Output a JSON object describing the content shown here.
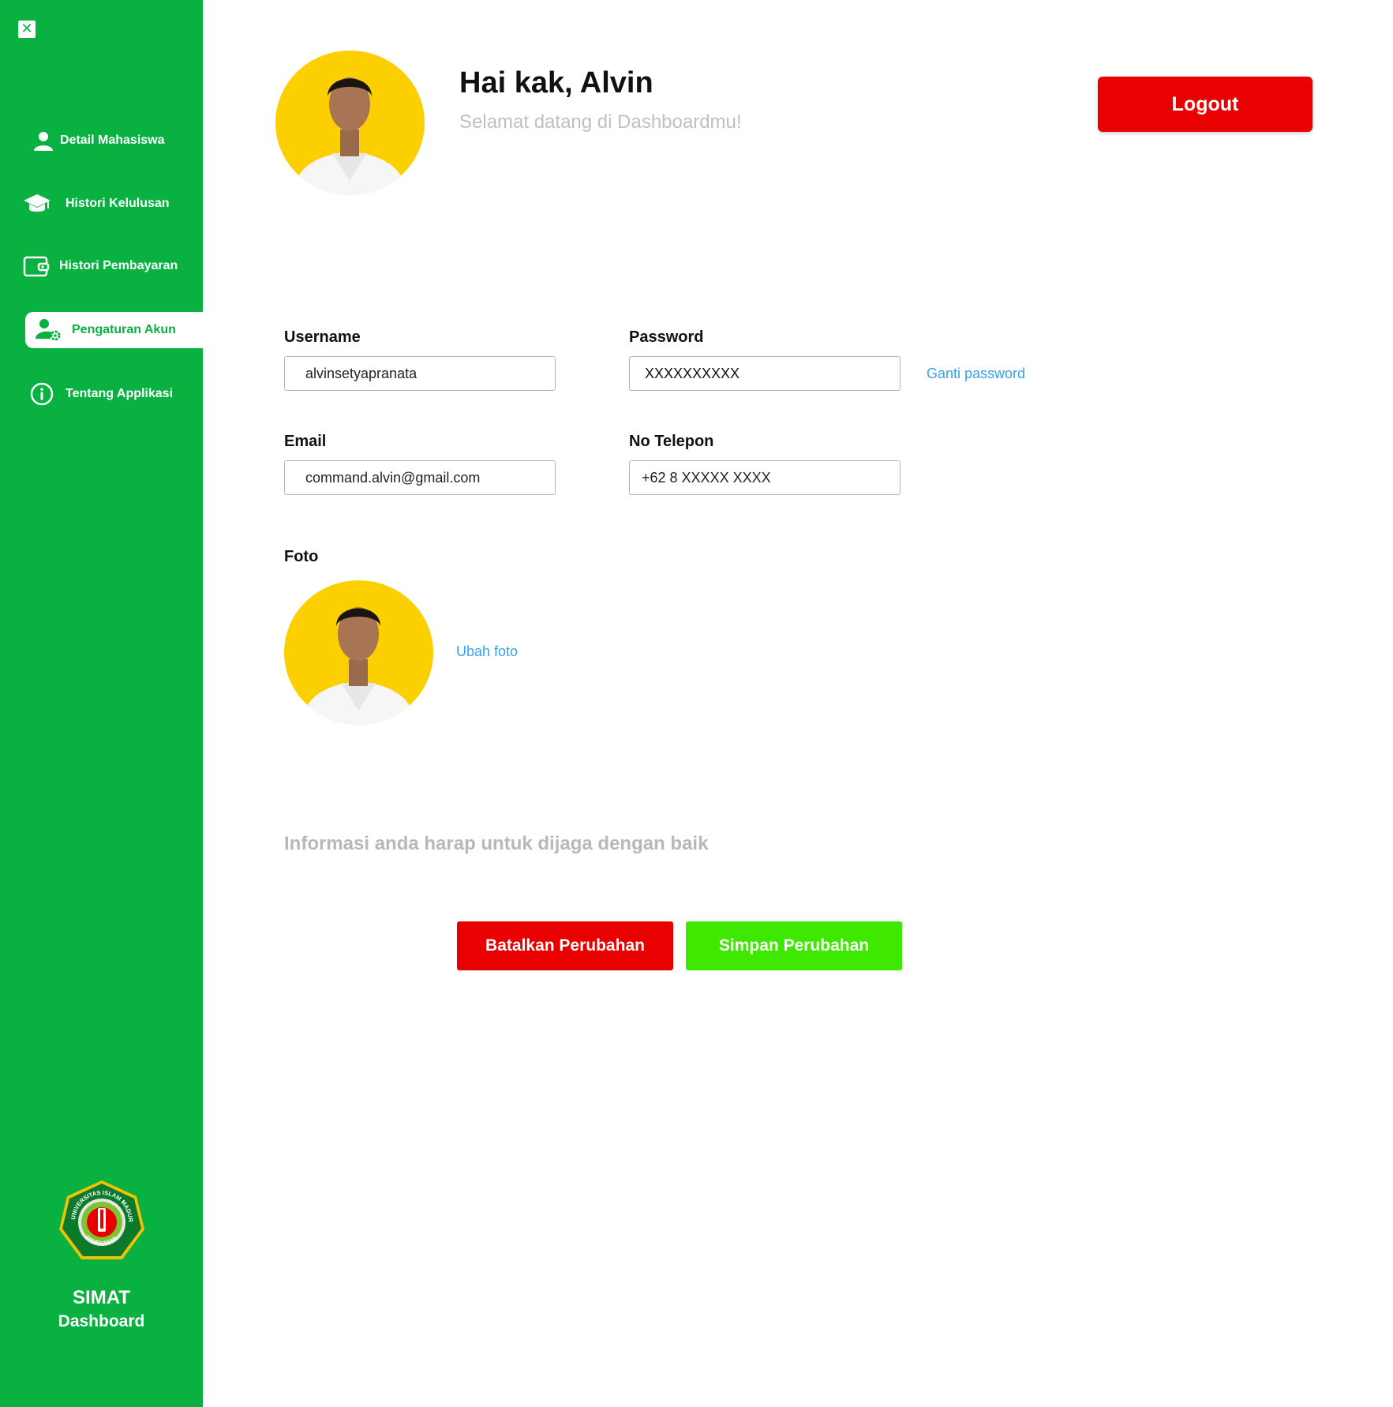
{
  "sidebar": {
    "close_icon": "close-icon",
    "items": [
      {
        "label": "Detail Mahasiswa",
        "icon": "user-icon",
        "active": false
      },
      {
        "label": "Histori Kelulusan",
        "icon": "graduation-cap-icon",
        "active": false
      },
      {
        "label": "Histori Pembayaran",
        "icon": "wallet-icon",
        "active": false
      },
      {
        "label": "Pengaturan Akun",
        "icon": "user-settings-icon",
        "active": true
      },
      {
        "label": "Tentang Applikasi",
        "icon": "info-icon",
        "active": false
      }
    ],
    "logo": {
      "top_text": "UNIVERSITAS ISLAM MADURA",
      "bottom_text": "PAMEKASAN"
    },
    "brand_title": "SIMAT",
    "brand_subtitle": "Dashboard"
  },
  "header": {
    "greeting": "Hai kak, Alvin",
    "welcome": "Selamat datang di Dashboardmu!",
    "logout_label": "Logout"
  },
  "form": {
    "username": {
      "label": "Username",
      "value": "alvinsetyapranata"
    },
    "password": {
      "label": "Password",
      "value": "XXXXXXXXXX",
      "change_link": "Ganti password"
    },
    "email": {
      "label": "Email",
      "value": "command.alvin@gmail.com"
    },
    "phone": {
      "label": "No Telepon",
      "value": "+62 8 XXXXX XXXX"
    },
    "photo": {
      "label": "Foto",
      "change_link": "Ubah foto"
    }
  },
  "info_text": "Informasi anda harap untuk dijaga dengan baik",
  "actions": {
    "cancel_label": "Batalkan Perubahan",
    "save_label": "Simpan Perubahan"
  },
  "colors": {
    "sidebar_green": "#08b140",
    "logout_red": "#e90000",
    "save_green": "#3fe800",
    "link_blue": "#3aa0e8",
    "avatar_yellow": "#fcd000"
  }
}
